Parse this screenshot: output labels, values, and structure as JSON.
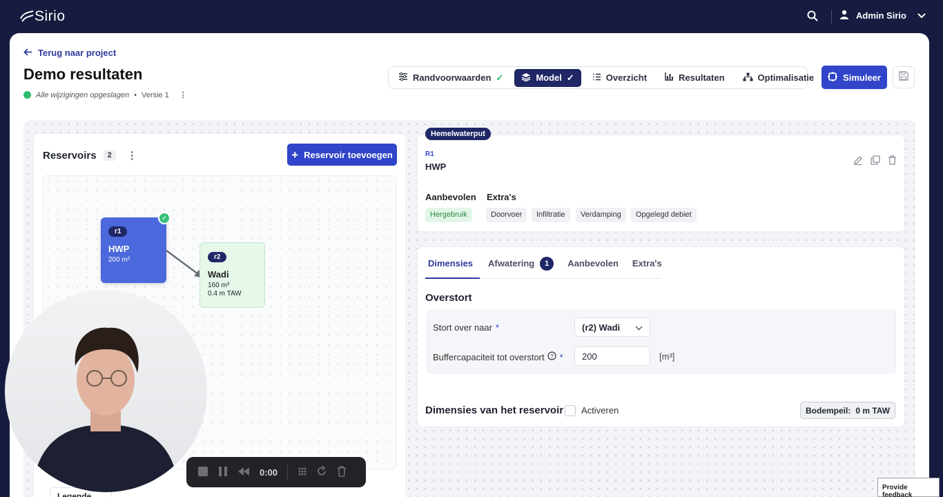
{
  "app": {
    "logo_text": "Sirio",
    "user_name": "Admin Sirio"
  },
  "header": {
    "back_label": "Terug naar project",
    "title": "Demo resultaten",
    "save_status": "Alle wijzigingen opgeslagen",
    "version": "Versie 1"
  },
  "nav": {
    "tabs": [
      {
        "label": "Randvoorwaarden",
        "done": true
      },
      {
        "label": "Model",
        "done": true,
        "active": true
      },
      {
        "label": "Overzicht"
      },
      {
        "label": "Resultaten"
      },
      {
        "label": "Optimalisatie"
      }
    ],
    "simulate_label": "Simuleer"
  },
  "reservoirs": {
    "title": "Reservoirs",
    "count": "2",
    "add_label": "Reservoir toevoegen",
    "nodes": [
      {
        "tag": "r1",
        "name": "HWP",
        "line1": "200 m³",
        "line2": ""
      },
      {
        "tag": "r2",
        "name": "Wadi",
        "line1": "160 m³",
        "line2": "0.4 m TAW"
      }
    ],
    "legend_label": "Legende"
  },
  "recorder": {
    "time": "0:00"
  },
  "detail": {
    "type_badge": "Hemelwaterput",
    "code": "R1",
    "name": "HWP",
    "recommended_label": "Aanbevolen",
    "extras_label": "Extra's",
    "chips": [
      "Hergebruik",
      "Doorvoer",
      "Infiltratie",
      "Verdamping",
      "Opgelegd debiet"
    ]
  },
  "form": {
    "tabs": [
      "Dimensies",
      "Afwatering",
      "Aanbevolen",
      "Extra's"
    ],
    "afwatering_badge": "1",
    "overstort_title": "Overstort",
    "stort_label": "Stort over naar",
    "stort_value": "(r2) Wadi",
    "buffer_label": "Buffercapaciteit tot overstort",
    "buffer_value": "200",
    "buffer_unit": "[m³]",
    "required_mark": "*",
    "dim_title": "Dimensies van het reservoir",
    "activate_label": "Activeren",
    "bodem_label": "Bodempeil:",
    "bodem_value": "0 m TAW"
  },
  "feedback_label": "Provide feedback",
  "colors": {
    "primary": "#3045c9",
    "navy": "#1f2766",
    "success": "#2dbb6b"
  }
}
